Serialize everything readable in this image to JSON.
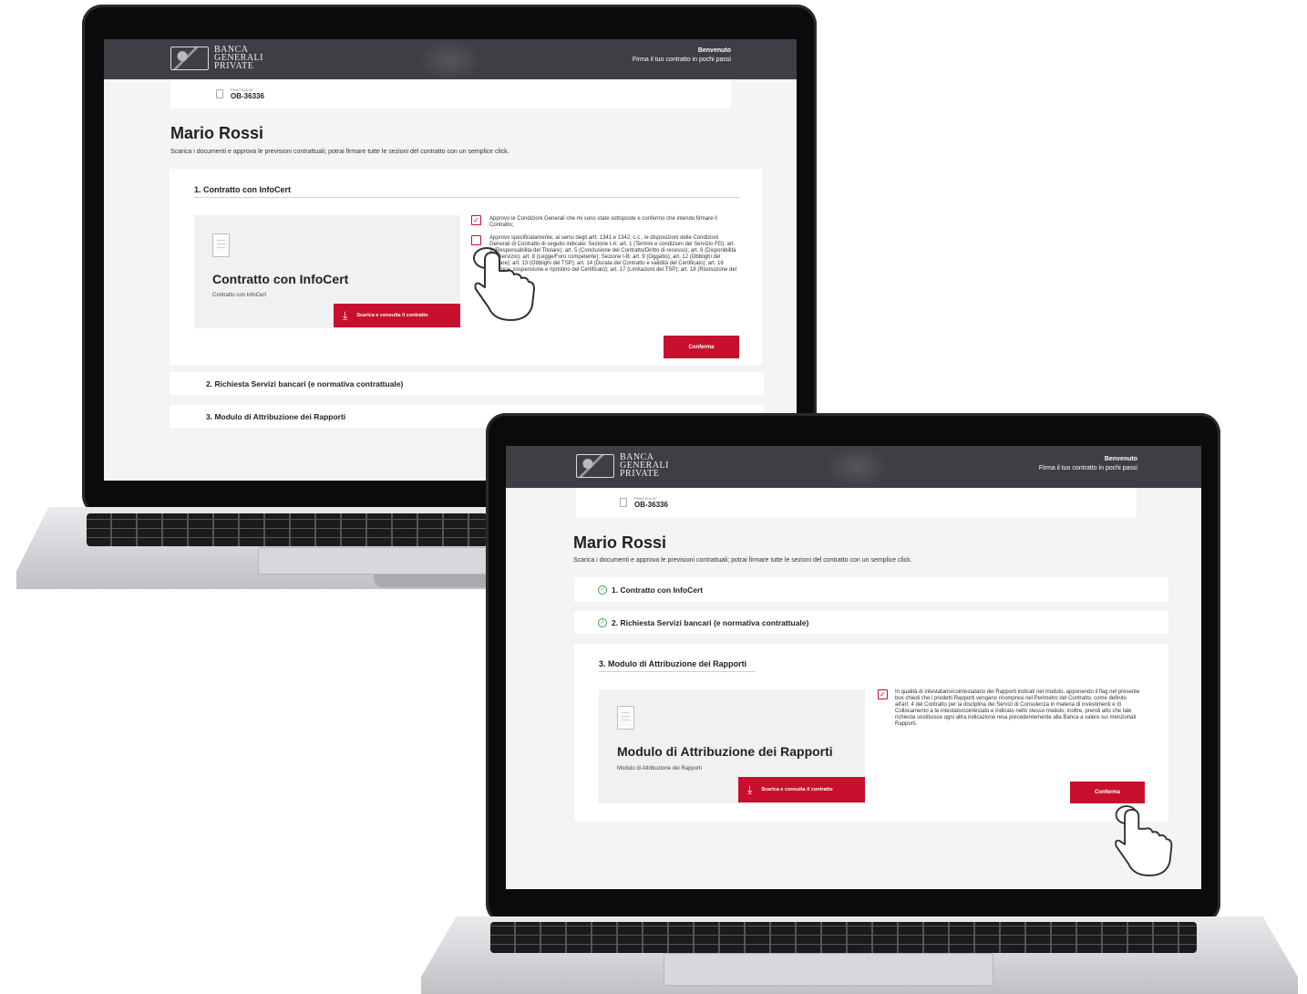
{
  "screen_a": {
    "header": {
      "logo_line1": "BANCA",
      "logo_line2": "GENERALI",
      "logo_line3": "PRIVATE",
      "welcome_title": "Benvenuto",
      "welcome_sub": "Firma il tuo contratto in pochi passi"
    },
    "pratica": {
      "label": "PRATICA N°",
      "code": "OB-36336"
    },
    "user_name": "Mario Rossi",
    "subtitle": "Scarica i documenti e approva le previsioni contrattuali; potrai firmare tutte le sezioni del contratto con un semplice click.",
    "section1": {
      "title": "1. Contratto con InfoCert",
      "doc_title": "Contratto con InfoCert",
      "doc_sub": "Contratto con InfoCert",
      "download_label": "Scarica e consulta il contratto",
      "clause1": "Approvo le Condizioni Generali che mi sono state sottoposte e confermo che intendo firmare il Contratto;",
      "clause2": "Approvo specificatamente, ai sensi degli artt. 1341 e 1342, c.c., le disposizioni delle Condizioni Generali di Contratto di seguito indicate: Sezione I-A: art. 1 (Termini e condizioni del Servizio FD); art. 3 (Responsabilità del Titolare); art. 5 (Conclusione del Contratto/Diritto di recesso); art. 6 (Disponibilità del Servizio); art. 8 (Legge/Foro competente); Sezione I-B: art. 9 (Oggetto); art. 12 (Obblighi del Titolare); art. 13 (Obblighi del TSP); art. 14 (Durata del Contratto e validità del Certificato); art. 16 (Revoca, sospensione e ripristino del Certificato); art. 17 (Limitazioni del TSP); art. 18 (Risoluzione del rapporto).",
      "confirm_label": "Conferma"
    },
    "section2_title": "2. Richiesta Servizi bancari (e normativa contrattuale)",
    "section3_title": "3. Modulo di Attribuzione dei Rapporti"
  },
  "screen_b": {
    "header": {
      "logo_line1": "BANCA",
      "logo_line2": "GENERALI",
      "logo_line3": "PRIVATE",
      "welcome_title": "Benvenuto",
      "welcome_sub": "Firma il tuo contratto in pochi passi"
    },
    "pratica": {
      "label": "PRATICA N°",
      "code": "OB-36336"
    },
    "user_name": "Mario Rossi",
    "subtitle": "Scarica i documenti e approva le previsioni contrattuali; potrai firmare tutte le sezioni del contratto con un semplice click.",
    "done1_title": "1. Contratto con InfoCert",
    "done2_title": "2. Richiesta Servizi bancari (e normativa contrattuale)",
    "section3": {
      "title": "3. Modulo di Attribuzione dei Rapporti",
      "doc_title": "Modulo di Attribuzione dei Rapporti",
      "doc_sub": "Modulo di Attribuzione dei Rapporti",
      "download_label": "Scarica e consulta il contratto",
      "clause": "In qualità di intestatario/cointestatario dei Rapporti indicati nel modulo, apponendo il flag nel presente box chiedi che i predetti Rapporti vengano ricompresi nel Perimetro del Contratto, come definito all'art. 4 del Contratto per la disciplina dei Servizi di Consulenza in materia di investimenti e di Collocamento a te intestato/cointestato e indicato nello stesso modulo; inoltre, prendi atto che tale richiesta sostituisce ogni altra indicazione resa precedentemente alla Banca a valere sui menzionati Rapporti.",
      "confirm_label": "Conferma"
    }
  },
  "icons": {
    "check": "✓",
    "ok": "✓",
    "download": "⤓"
  },
  "colors": {
    "header_bg": "#3d3f45",
    "brand_red": "#c8102e",
    "success_green": "#3aa14a"
  }
}
